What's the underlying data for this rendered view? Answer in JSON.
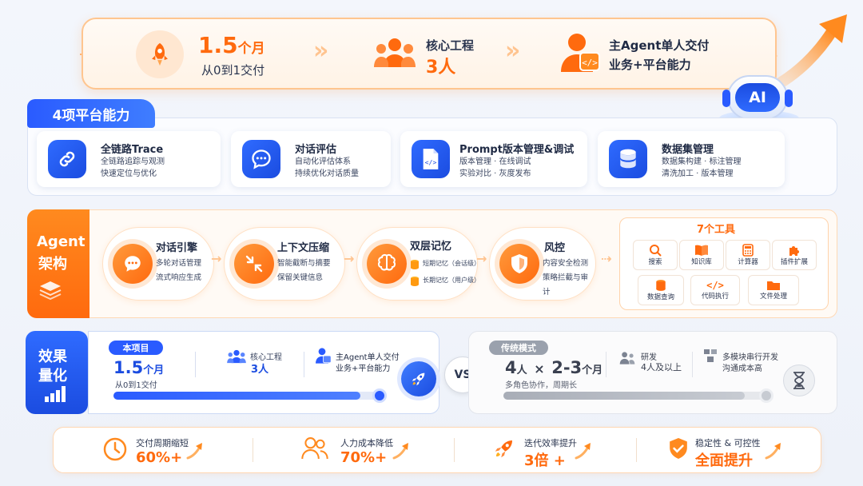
{
  "banner": {
    "duration_value": "1.5",
    "duration_unit": "个月",
    "duration_desc": "从0到1交付",
    "team_label": "核心工程",
    "team_value": "3人",
    "owner_line1": "主Agent单人交付",
    "owner_line2": "业务+平台能力"
  },
  "ai_badge": "AI",
  "platform": {
    "tag": "4项平台能力",
    "items": [
      {
        "title": "全链路Trace",
        "desc1": "全链路追踪与观测",
        "desc2": "快速定位与优化"
      },
      {
        "title": "对话评估",
        "desc1": "自动化评估体系",
        "desc2": "持续优化对话质量"
      },
      {
        "title": "Prompt版本管理&调试",
        "desc1": "版本管理 · 在线调试",
        "desc2": "实验对比 · 灰度发布"
      },
      {
        "title": "数据集管理",
        "desc1": "数据集构建 · 标注管理",
        "desc2": "清洗加工 · 版本管理"
      }
    ]
  },
  "agent": {
    "side_line1": "Agent",
    "side_line2": "架构",
    "modules": [
      {
        "title": "对话引擎",
        "desc1": "多轮对话管理",
        "desc2": "流式响应生成"
      },
      {
        "title": "上下文压缩",
        "desc1": "智能截断与摘要",
        "desc2": "保留关键信息"
      },
      {
        "title": "双层记忆",
        "desc1": "短期记忆（会话级）",
        "desc2": "长期记忆（用户级）"
      },
      {
        "title": "风控",
        "desc1": "内容安全检测",
        "desc2": "策略拦截与审计"
      }
    ],
    "tools_title": "7个工具",
    "tools": [
      "搜索",
      "知识库",
      "计算器",
      "插件扩展",
      "数据查询",
      "代码执行",
      "文件处理"
    ]
  },
  "effect": {
    "side_line1": "效果",
    "side_line2": "量化",
    "project_tag": "本项目",
    "project_value": "1.5",
    "project_unit": "个月",
    "project_desc": "从0到1交付",
    "team_label": "核心工程",
    "team_value": "3人",
    "owner_line1": "主Agent单人交付",
    "owner_line2": "业务+平台能力",
    "project_progress": 0.92,
    "vs": "VS",
    "trad_tag": "传统模式",
    "trad_people": "4",
    "trad_people_unit": "人",
    "trad_times": "×",
    "trad_months": "2-3",
    "trad_months_unit": "个月",
    "trad_desc": "多角色协作，周期长",
    "trad_dev_label": "研发",
    "trad_dev_value": "4人及以上",
    "trad_serial_line1": "多模块串行开发",
    "trad_serial_line2": "沟通成本高",
    "trad_progress": 0.9
  },
  "bottom": [
    {
      "label": "交付周期缩短",
      "value": "60%+"
    },
    {
      "label": "人力成本降低",
      "value": "70%+"
    },
    {
      "label": "迭代效率提升",
      "value": "3倍 +"
    },
    {
      "label": "稳定性 & 可控性",
      "value": "全面提升"
    }
  ],
  "colors": {
    "orange": "#ff6a0e",
    "blue": "#2a5bff"
  }
}
